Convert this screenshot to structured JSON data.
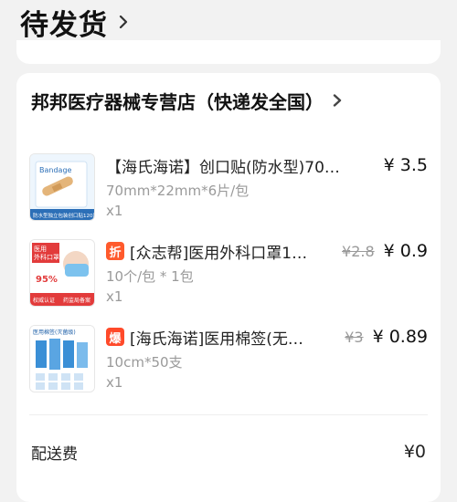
{
  "status": {
    "title": "待发货"
  },
  "shop": {
    "name": "邦邦医疗器械专营店（快递发全国）"
  },
  "items": [
    {
      "title": "【海氏海诺】创口贴(防水型)70…",
      "spec": "70mm*22mm*6片/包",
      "qty": "x1",
      "price": "¥ 3.5",
      "orig_price": "",
      "badge": "",
      "thumb": {
        "label": "Bandage",
        "bottom_text": "防水型独立包装创口贴120片",
        "colors": [
          "#e9f3fb",
          "#2c6fb7"
        ]
      }
    },
    {
      "title": "[众志帮]医用外科口罩1…",
      "spec": "10个/包 * 1包",
      "qty": "x1",
      "price": "¥ 0.9",
      "orig_price": "¥2.8",
      "badge": "折",
      "badge_color": "#ff5a2c",
      "thumb": {
        "label": "医用外科口罩",
        "percent": "95%",
        "tag1": "权威认证",
        "tag2": "药监局备案",
        "colors": [
          "#fdeaea",
          "#e23b3b"
        ]
      }
    },
    {
      "title": "[海氏海诺]医用棉签(无…",
      "spec": "10cm*50支",
      "qty": "x1",
      "price": "¥ 0.89",
      "orig_price": "¥3",
      "badge": "爆",
      "badge_color": "#ff4a2a",
      "thumb": {
        "label": "医用棉签(灭菌级)",
        "colors": [
          "#ffffff",
          "#3a8fd6"
        ]
      }
    }
  ],
  "shipping": {
    "label": "配送费",
    "value": "¥0"
  }
}
